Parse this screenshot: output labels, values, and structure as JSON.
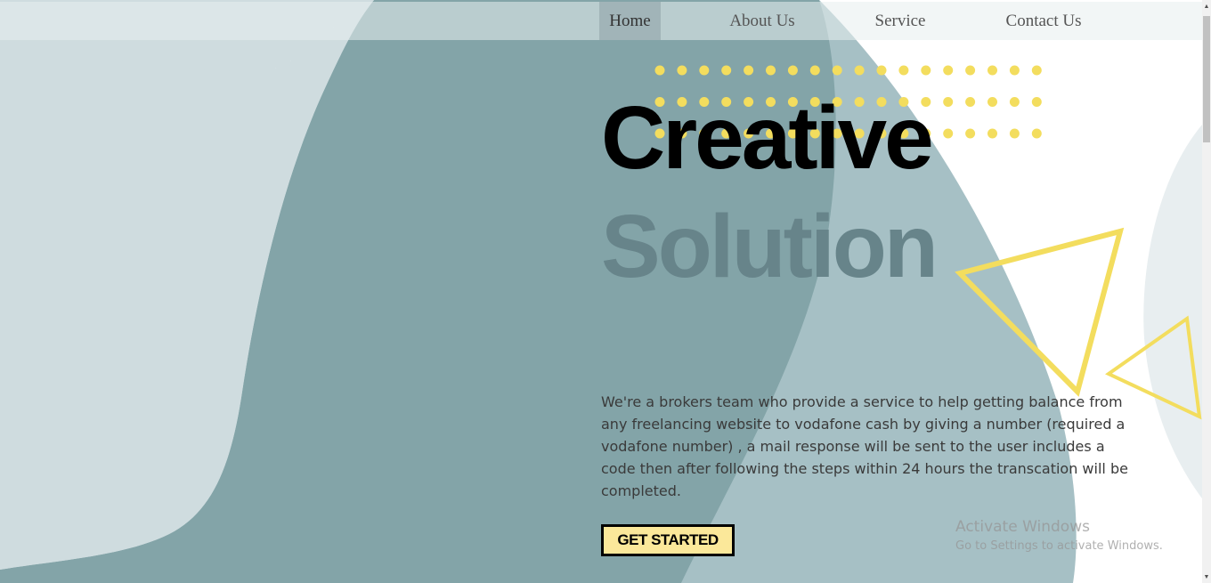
{
  "nav": {
    "items": [
      {
        "label": "Home",
        "active": true
      },
      {
        "label": "About Us",
        "active": false
      },
      {
        "label": "Service",
        "active": false
      },
      {
        "label": "Contact Us",
        "active": false
      }
    ]
  },
  "hero": {
    "title_line1": "Creative",
    "title_line2": "Solution",
    "description": "We're a brokers team who provide a service to help getting balance from any freelancing website to vodafone cash by giving a number (required a vodafone number) , a mail response will be sent to the user includes a code then after following the steps within 24 hours the transcation will be completed.",
    "cta_label": "GET STARTED"
  },
  "watermark": {
    "line1": "Activate Windows",
    "line2": "Go to Settings to activate Windows."
  },
  "colors": {
    "blob_light": "#cfdcdf",
    "blob_dark": "#83a4a8",
    "blob_mid": "#a6c0c5",
    "accent_yellow": "#f3dd5e",
    "button_fill": "#fbe89a",
    "solution_text": "#67848a"
  },
  "icons": {
    "scroll_up": "triangle-up",
    "scroll_down": "triangle-down"
  }
}
